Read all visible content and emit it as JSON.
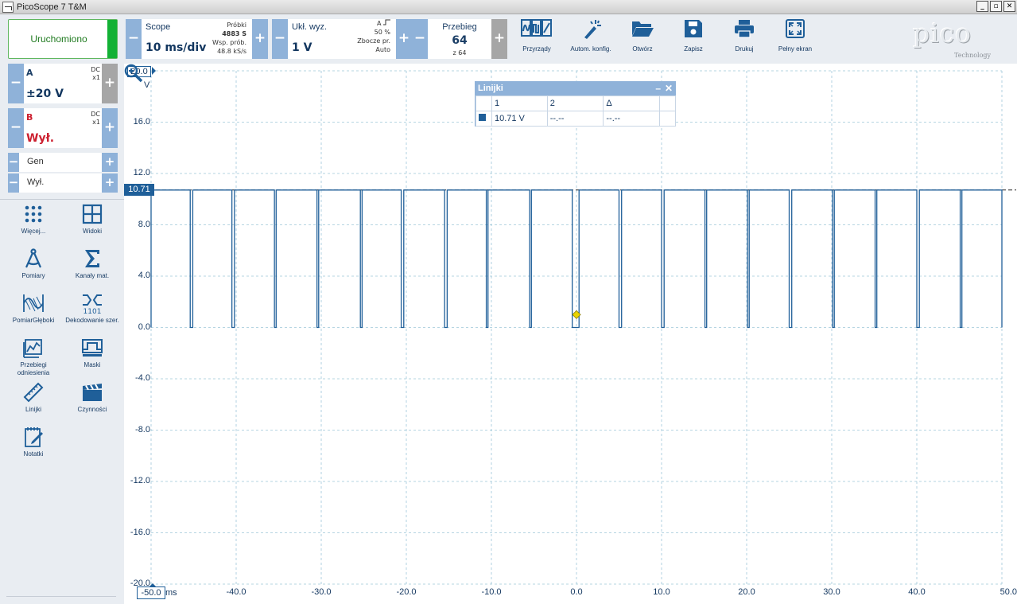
{
  "window": {
    "title": "PicoScope 7 T&M",
    "buttons": {
      "minimize": "_",
      "restore": "▫",
      "close": "✕"
    }
  },
  "run_button": {
    "label": "Uruchomiono",
    "color": "#13b135"
  },
  "channels": [
    {
      "name": "A",
      "coupling": "DC",
      "probe": "x1",
      "range": "±20 V",
      "color": "#12365f"
    },
    {
      "name": "B",
      "coupling": "DC",
      "probe": "x1",
      "range": "Wył.",
      "color": "#cc1f2f"
    }
  ],
  "generator": {
    "label": "Gen",
    "state": "Wył."
  },
  "side_tools": [
    {
      "label": "Więcej...",
      "icon": "more-dots-icon"
    },
    {
      "label": "Widoki",
      "icon": "views-grid-icon"
    },
    {
      "label": "Pomiary",
      "icon": "measurement-caliper-icon"
    },
    {
      "label": "Kanały mat.",
      "icon": "sigma-icon"
    },
    {
      "label": "PomiarGłęboki",
      "icon": "deep-measure-icon"
    },
    {
      "label": "Dekodowanie szer.",
      "icon": "serial-decode-icon"
    },
    {
      "label": "Przebiegi odniesienia",
      "icon": "reference-waveform-icon"
    },
    {
      "label": "Maski",
      "icon": "mask-icon"
    },
    {
      "label": "Linijki",
      "icon": "ruler-icon"
    },
    {
      "label": "Czynności",
      "icon": "clapper-icon"
    },
    {
      "label": "Notatki",
      "icon": "notes-icon"
    }
  ],
  "timebase": {
    "label": "Scope",
    "value": "10 ms/div",
    "samples_label": "Próbki",
    "samples": "4883 S",
    "rate_label": "Wsp. prób.",
    "rate": "48.8 kS/s"
  },
  "trigger": {
    "label": "Ukł. wyz.",
    "level": "1 V",
    "source": "A",
    "edge_icon": "rising-edge-icon",
    "percent": "50 %",
    "type": "Zbocze pr.",
    "mode": "Auto"
  },
  "buffer": {
    "label": "Przebieg",
    "value": "64",
    "total": "z 64"
  },
  "toolbar_buttons": [
    {
      "label": "Przyrządy",
      "icon": "instruments-icon"
    },
    {
      "label": "Autom. konfig.",
      "icon": "auto-setup-icon"
    },
    {
      "label": "Otwórz",
      "icon": "folder-open-icon"
    },
    {
      "label": "Zapisz",
      "icon": "save-icon"
    },
    {
      "label": "Drukuj",
      "icon": "print-icon"
    },
    {
      "label": "Pełny ekran",
      "icon": "fullscreen-icon"
    }
  ],
  "logo": {
    "word": "pico",
    "sub": "Technology"
  },
  "plot": {
    "y_max_box": "20.0",
    "y_unit": "V",
    "y_ticks": [
      "16.0",
      "12.0",
      "8.0",
      "4.0",
      "0.0",
      "-4.0",
      "-8.0",
      "-12.0",
      "-16.0",
      "-20.0"
    ],
    "x_min_box": "-50.0",
    "x_unit": "ms",
    "x_ticks": [
      "-40.0",
      "-30.0",
      "-20.0",
      "-10.0",
      "0.0",
      "10.0",
      "20.0",
      "30.0",
      "40.0",
      "50.0"
    ],
    "ruler_value": "10.71",
    "trace_color": "#1f5f99",
    "grid_color": "#9fc7d9",
    "trigger_marker_color": "#e8d400"
  },
  "rulers_window": {
    "title": "Linijki",
    "headers": [
      "1",
      "2",
      "Δ"
    ],
    "row": [
      "10.71 V",
      "--.--",
      "--.--"
    ]
  },
  "chart_data": {
    "type": "line",
    "xlabel": "ms",
    "ylabel": "V",
    "xlim": [
      -50,
      50
    ],
    "ylim": [
      -20,
      20
    ],
    "grid": true,
    "series": [
      {
        "name": "A",
        "high": 10.71,
        "low": 0.0,
        "pulse_periods": [
          [
            -50.0,
            -45.4
          ],
          [
            -45.1,
            -40.5
          ],
          [
            -40.2,
            -35.5
          ],
          [
            -35.3,
            -30.5
          ],
          [
            -30.3,
            -25.4
          ],
          [
            -25.2,
            -20.6
          ],
          [
            -20.3,
            -15.5
          ],
          [
            -15.2,
            -10.6
          ],
          [
            -10.4,
            -5.5
          ],
          [
            -5.3,
            -0.5
          ],
          [
            0.3,
            5.0
          ],
          [
            5.3,
            10.0
          ],
          [
            10.3,
            15.1
          ],
          [
            15.3,
            20.1
          ],
          [
            20.3,
            25.0
          ],
          [
            25.3,
            30.1
          ],
          [
            30.3,
            35.1
          ],
          [
            35.3,
            40.0
          ],
          [
            40.3,
            45.1
          ],
          [
            45.3,
            50.0
          ]
        ]
      }
    ],
    "ruler_level": 10.71,
    "trigger": {
      "x": 0.0,
      "y": 1.0
    }
  }
}
